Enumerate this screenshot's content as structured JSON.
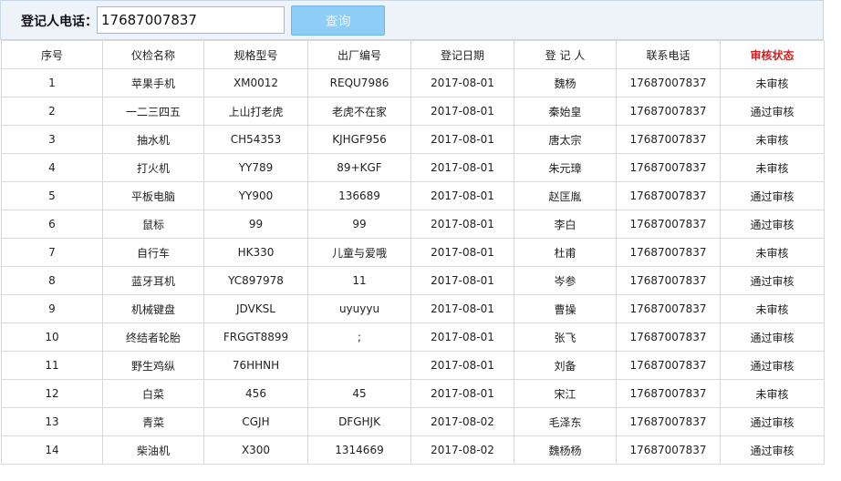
{
  "search": {
    "label": "登记人电话：",
    "value": "17687007837",
    "button_label": "查询"
  },
  "table": {
    "columns": [
      "序号",
      "仪检名称",
      "规格型号",
      "出厂编号",
      "登记日期",
      "登 记 人",
      "联系电话",
      "审核状态"
    ],
    "status_header_color": "#d42020",
    "rows": [
      [
        "1",
        "苹果手机",
        "XM0012",
        "REQU7986",
        "2017-08-01",
        "魏杨",
        "17687007837",
        "未审核"
      ],
      [
        "2",
        "一二三四五",
        "上山打老虎",
        "老虎不在家",
        "2017-08-01",
        "秦始皇",
        "17687007837",
        "通过审核"
      ],
      [
        "3",
        "抽水机",
        "CH54353",
        "KJHGF956",
        "2017-08-01",
        "唐太宗",
        "17687007837",
        "未审核"
      ],
      [
        "4",
        "打火机",
        "YY789",
        "89+KGF",
        "2017-08-01",
        "朱元璋",
        "17687007837",
        "未审核"
      ],
      [
        "5",
        "平板电脑",
        "YY900",
        "136689",
        "2017-08-01",
        "赵匡胤",
        "17687007837",
        "通过审核"
      ],
      [
        "6",
        "鼠标",
        "99",
        "99",
        "2017-08-01",
        "李白",
        "17687007837",
        "通过审核"
      ],
      [
        "7",
        "自行车",
        "HK330",
        "儿童与爱哦",
        "2017-08-01",
        "杜甫",
        "17687007837",
        "未审核"
      ],
      [
        "8",
        "蓝牙耳机",
        "YC897978",
        "11",
        "2017-08-01",
        "岑参",
        "17687007837",
        "通过审核"
      ],
      [
        "9",
        "机械键盘",
        "JDVKSL",
        "uyuyyu",
        "2017-08-01",
        "曹操",
        "17687007837",
        "未审核"
      ],
      [
        "10",
        "终结者轮胎",
        "FRGGT8899",
        ";",
        "2017-08-01",
        "张飞",
        "17687007837",
        "通过审核"
      ],
      [
        "11",
        "野生鸡纵",
        "76HHNH",
        "",
        "2017-08-01",
        "刘备",
        "17687007837",
        "通过审核"
      ],
      [
        "12",
        "白菜",
        "456",
        "45",
        "2017-08-01",
        "宋江",
        "17687007837",
        "未审核"
      ],
      [
        "13",
        "青菜",
        "CGJH",
        "DFGHJK",
        "2017-08-02",
        "毛泽东",
        "17687007837",
        "通过审核"
      ],
      [
        "14",
        "柴油机",
        "X300",
        "1314669",
        "2017-08-02",
        "魏杨杨",
        "17687007837",
        "通过审核"
      ]
    ]
  }
}
